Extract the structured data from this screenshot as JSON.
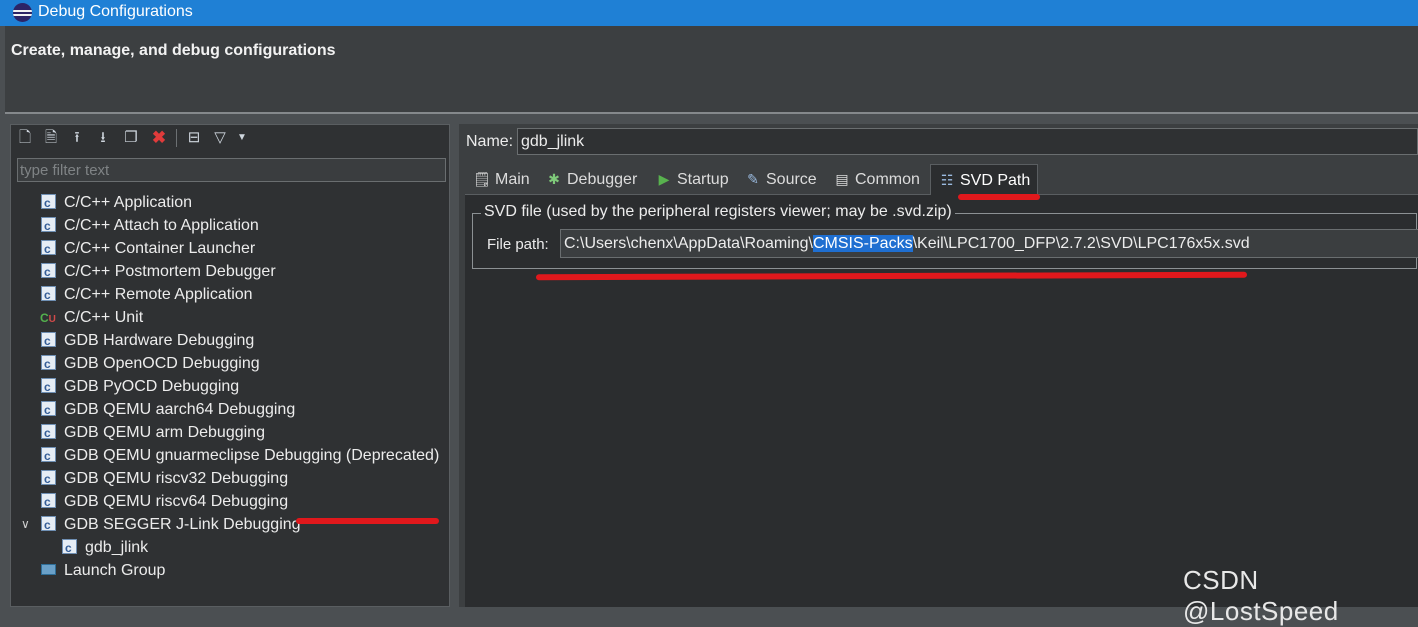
{
  "window": {
    "title": "Debug Configurations",
    "headline": "Create, manage, and debug configurations"
  },
  "toolbar": {
    "buttons": [
      "new-configuration-icon",
      "new-prototype-icon",
      "export-icon",
      "import-icon",
      "duplicate-icon",
      "delete-icon",
      "collapse-all-icon",
      "filter-icon",
      "dropdown-arrow-icon"
    ]
  },
  "filter": {
    "placeholder": "type filter text"
  },
  "tree": {
    "items": [
      {
        "label": "C/C++ Application",
        "icon": "c-config-icon"
      },
      {
        "label": "C/C++ Attach to Application",
        "icon": "c-config-icon"
      },
      {
        "label": "C/C++ Container Launcher",
        "icon": "c-config-icon"
      },
      {
        "label": "C/C++ Postmortem Debugger",
        "icon": "c-config-icon"
      },
      {
        "label": "C/C++ Remote Application",
        "icon": "c-config-icon"
      },
      {
        "label": "C/C++ Unit",
        "icon": "c-unit-icon"
      },
      {
        "label": "GDB Hardware Debugging",
        "icon": "c-config-icon"
      },
      {
        "label": "GDB OpenOCD Debugging",
        "icon": "c-config-icon"
      },
      {
        "label": "GDB PyOCD Debugging",
        "icon": "c-config-icon"
      },
      {
        "label": "GDB QEMU aarch64 Debugging",
        "icon": "c-config-icon"
      },
      {
        "label": "GDB QEMU arm Debugging",
        "icon": "c-config-icon"
      },
      {
        "label": "GDB QEMU gnuarmeclipse Debugging (Deprecated)",
        "icon": "c-config-icon"
      },
      {
        "label": "GDB QEMU riscv32 Debugging",
        "icon": "c-config-icon"
      },
      {
        "label": "GDB QEMU riscv64 Debugging",
        "icon": "c-config-icon"
      },
      {
        "label": "GDB SEGGER J-Link Debugging",
        "icon": "c-config-icon",
        "expanded": true
      },
      {
        "label": "gdb_jlink",
        "icon": "c-config-icon",
        "child": true
      },
      {
        "label": "Launch Group",
        "icon": "launch-group-icon"
      }
    ]
  },
  "right": {
    "name_label": "Name:",
    "name_value": "gdb_jlink",
    "tabs": [
      {
        "label": "Main",
        "icon": "main-tab-icon"
      },
      {
        "label": "Debugger",
        "icon": "debugger-tab-icon"
      },
      {
        "label": "Startup",
        "icon": "startup-tab-icon"
      },
      {
        "label": "Source",
        "icon": "source-tab-icon"
      },
      {
        "label": "Common",
        "icon": "common-tab-icon"
      },
      {
        "label": "SVD Path",
        "icon": "svd-path-tab-icon",
        "active": true
      }
    ],
    "group_title": "SVD file (used by the peripheral registers viewer; may be .svd.zip)",
    "file_path_label": "File path:",
    "file_path_before": "C:\\Users\\chenx\\AppData\\Roaming\\",
    "file_path_selected": "CMSIS-Packs",
    "file_path_after": "\\Keil\\LPC1700_DFP\\2.7.2\\SVD\\LPC176x5x.svd"
  },
  "watermark": "CSDN @LostSpeed",
  "colors": {
    "titlebar": "#1f80d5",
    "annotation_red": "#e0181c",
    "selection": "#1f6fd1"
  }
}
